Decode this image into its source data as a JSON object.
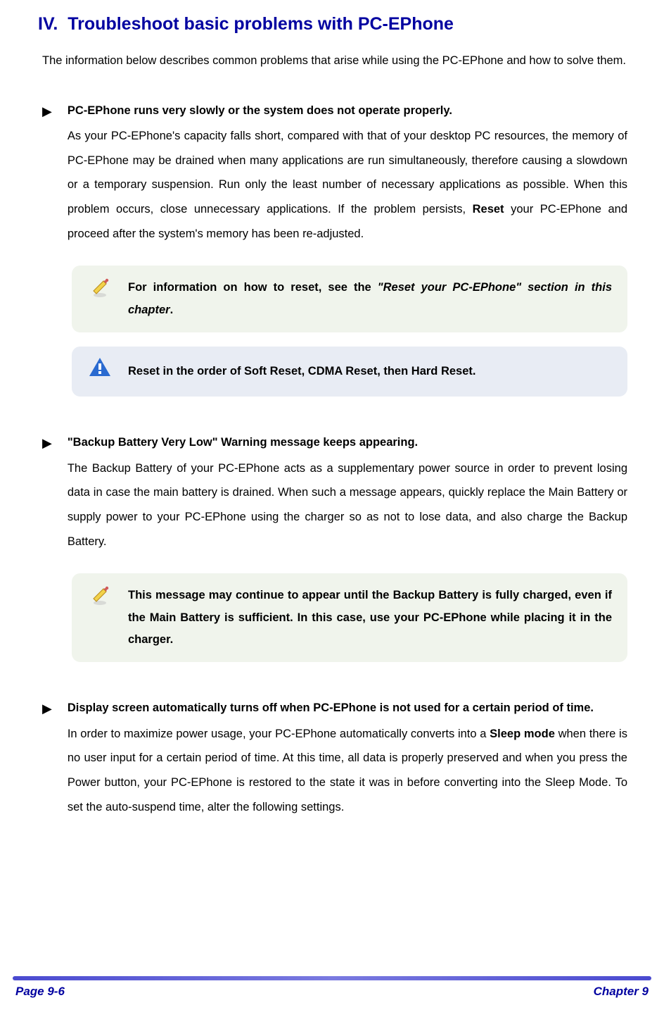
{
  "heading": {
    "number": "IV.",
    "title": "Troubleshoot basic problems with PC-EPhone"
  },
  "intro": "The information below describes common problems that arise while using the PC-EPhone and how to solve them.",
  "bullet": "▶",
  "items": [
    {
      "title": "PC-EPhone runs very slowly or the system does not operate properly.",
      "para_pre": "As your PC-EPhone's capacity falls short, compared with that of your desktop PC resources, the memory of PC-EPhone may be drained when many applications are run simultaneously, therefore causing a slowdown or a temporary suspension. Run only the least number of necessary applications as possible. When this problem occurs, close unnecessary applications. If the problem persists, ",
      "para_bold": "Reset",
      "para_post": " your PC-EPhone and proceed after the system's memory has been re-adjusted.",
      "note1_pre": "For information on how to reset, see the ",
      "note1_italic": "\"Reset your PC-EPhone\" section in this chapter",
      "note1_post": ".",
      "note2": "Reset in the order of Soft Reset, CDMA Reset, then Hard Reset."
    },
    {
      "title": "\"Backup Battery Very Low\" Warning message keeps appearing.",
      "para": "The Backup Battery of your PC-EPhone acts as a supplementary power source in order to prevent losing data in case the main battery is drained. When such a message appears, quickly replace the Main Battery or supply power to your PC-EPhone using the charger so as not to lose data, and also charge the Backup Battery.",
      "note": "This message may continue to appear until the Backup Battery is fully charged, even if the Main Battery is sufficient. In this case, use your PC-EPhone while placing it in the charger."
    },
    {
      "title": "Display screen automatically turns off when PC-EPhone is not used for a certain period of time.",
      "para_pre": "In order to maximize power usage, your PC-EPhone automatically converts into a ",
      "para_bold": "Sleep mode",
      "para_post": " when there is no user input for a certain period of time. At this time, all data is properly preserved and when you press the Power button, your PC-EPhone is restored to the state it was in before converting into the Sleep Mode. To set the auto-suspend time, alter the following settings."
    }
  ],
  "footer": {
    "left": "Page 9-6",
    "right": "Chapter 9"
  }
}
